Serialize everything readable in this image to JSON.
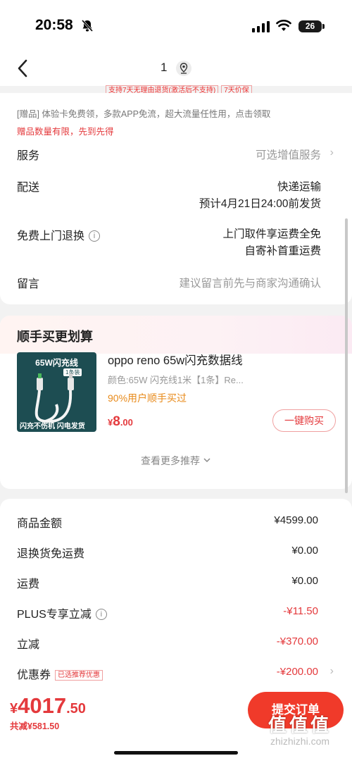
{
  "status_bar": {
    "time": "20:58",
    "battery": "26"
  },
  "nav": {
    "cart_count": "1",
    "peek_tags": [
      "支持7天无理由退货(激活后不支持)",
      "7天价保"
    ]
  },
  "gift_section": {
    "gift_text": "[赠品] 体验卡免费领，多款APP免流，超大流量任性用，点击领取",
    "gift_warning": "赠品数量有限，先到先得"
  },
  "order_options": {
    "service": {
      "label": "服务",
      "value": "可选增值服务"
    },
    "delivery": {
      "label": "配送",
      "method": "快递运输",
      "eta": "预计4月21日24:00前发货"
    },
    "return": {
      "label": "免费上门退换",
      "line1": "上门取件享运费全免",
      "line2": "自寄补首重运费"
    },
    "message": {
      "label": "留言",
      "placeholder": "建议留言前先与商家沟通确认"
    }
  },
  "recommend": {
    "title": "顺手买更划算",
    "product": {
      "image_title": "65W闪充线",
      "image_badge": "1条装",
      "image_footer": "闪充不伤机 闪电发货",
      "name": "oppo reno 65w闪充数据线",
      "spec": "颜色:65W 闪充线1米【1条】Re...",
      "bought": "90%用户顺手买过",
      "price_symbol": "¥",
      "price_int": "8",
      "price_dec": ".00",
      "buy_label": "一键购买"
    },
    "more_label": "查看更多推荐"
  },
  "fees": {
    "items": [
      {
        "label": "商品金额",
        "value": "¥4599.00"
      },
      {
        "label": "退换货免运费",
        "value": "¥0.00"
      },
      {
        "label": "运费",
        "value": "¥0.00"
      },
      {
        "label": "PLUS专享立减",
        "value": "-¥11.50"
      },
      {
        "label": "立减",
        "value": "-¥370.00"
      },
      {
        "label": "优惠券",
        "value": "-¥200.00",
        "badge": "已选推荐优惠"
      }
    ]
  },
  "checkout": {
    "total_symbol": "¥",
    "total_int": "4017",
    "total_dec": ".50",
    "saved": "共减¥581.50",
    "submit_label": "提交订单"
  },
  "watermark": {
    "logo": "值值值",
    "url": "zhizhizhi.com"
  },
  "colors": {
    "accent": "#e4393c",
    "submit": "#f03a2a",
    "orange": "#e88a1a"
  },
  "icons": [
    "bell-off-icon",
    "signal-icon",
    "wifi-icon",
    "battery-icon",
    "back-arrow-icon",
    "location-icon",
    "chevron-right-icon",
    "info-icon",
    "chevron-down-icon"
  ]
}
